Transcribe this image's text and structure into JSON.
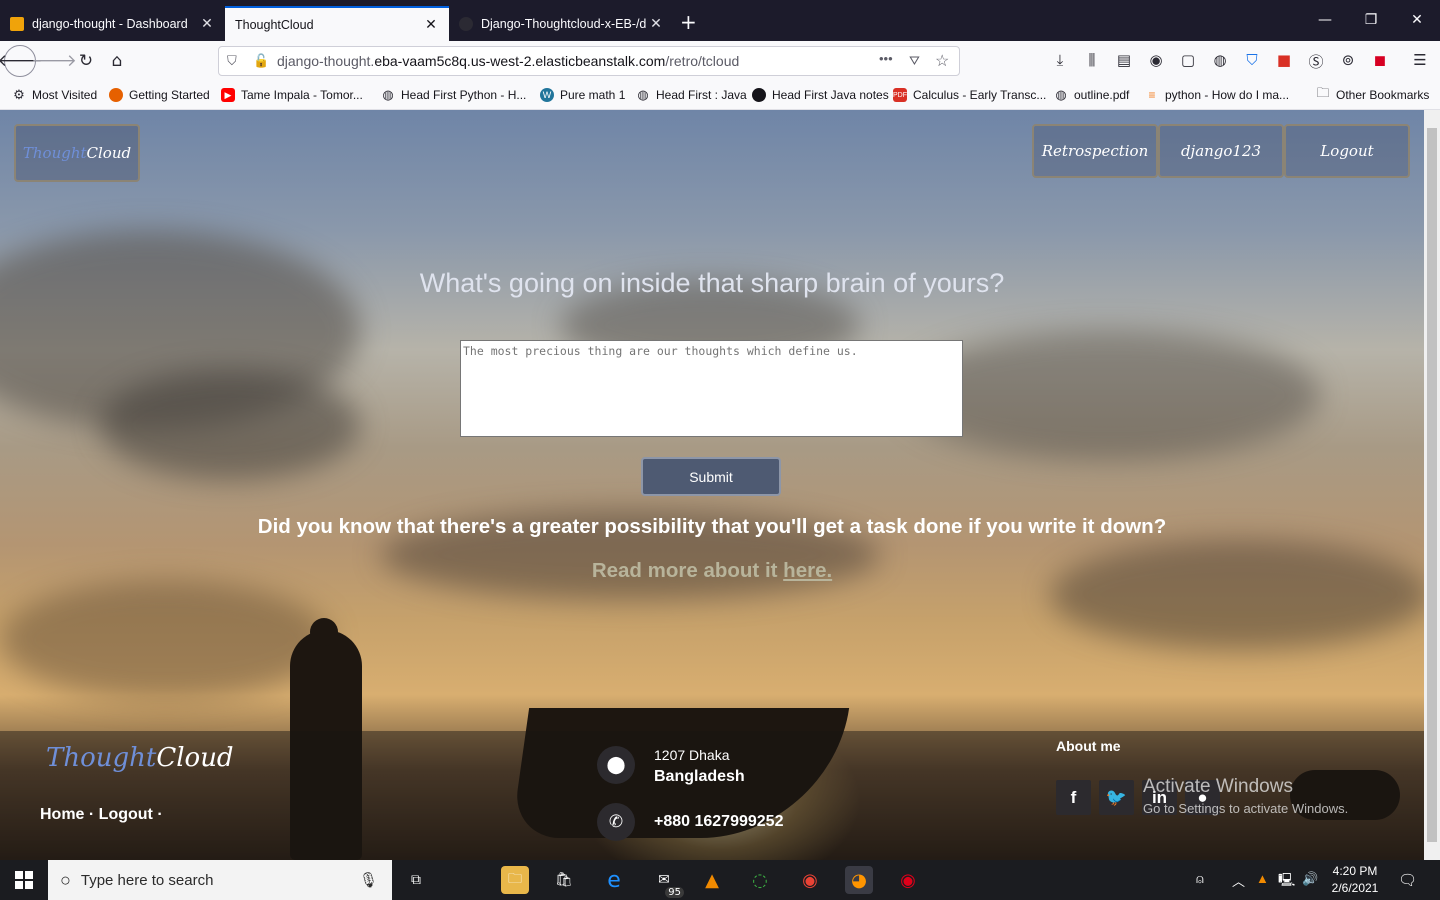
{
  "browser": {
    "tabs": [
      {
        "title": "django-thought - Dashboard",
        "active": false,
        "icon": "aws-box-icon"
      },
      {
        "title": "ThoughtCloud",
        "active": true,
        "icon": ""
      },
      {
        "title": "Django-Thoughtcloud-x-EB-/d",
        "active": false,
        "icon": "github-icon"
      }
    ],
    "url_prefix": "django-thought.",
    "url_domain": "eba-vaam5c8q.us-west-2.elasticbeanstalk.com",
    "url_path": "/retro/tcloud",
    "bookmarks": [
      {
        "label": "Most Visited",
        "icon": "gear-icon"
      },
      {
        "label": "Getting Started",
        "icon": "firefox-icon"
      },
      {
        "label": "Tame Impala - Tomor...",
        "icon": "youtube-icon"
      },
      {
        "label": "Head First Python - H...",
        "icon": "globe-icon"
      },
      {
        "label": "Pure math 1",
        "icon": "wordpress-icon"
      },
      {
        "label": "Head First : Java",
        "icon": "globe-icon"
      },
      {
        "label": "Head First Java notes",
        "icon": "github-icon"
      },
      {
        "label": "Calculus - Early Transc...",
        "icon": "pdf-icon"
      },
      {
        "label": "outline.pdf",
        "icon": "globe-icon"
      },
      {
        "label": "python - How do I ma...",
        "icon": "stackoverflow-icon"
      },
      {
        "label": "Other Bookmarks",
        "icon": "folder-icon"
      }
    ]
  },
  "page": {
    "brand_part1": "Thought",
    "brand_part2": "Cloud",
    "nav": {
      "retrospection": "Retrospection",
      "user": "django123",
      "logout": "Logout"
    },
    "headline": "What's going on inside that sharp brain of yours?",
    "thought_placeholder": "The most precious thing are our thoughts which define us.",
    "submit_label": "Submit",
    "question": "Did you know that there's a greater possibility that you'll get a task done if you write it down?",
    "readmore_text": "Read more about it ",
    "readmore_link": "here."
  },
  "footer": {
    "logo_part1": "Thought",
    "logo_part2": "Cloud",
    "links": "Home · Logout ·",
    "address_line1": "1207 Dhaka",
    "address_line2": "Bangladesh",
    "phone": "+880 1627999252",
    "about_title": "About me",
    "social": [
      "facebook",
      "twitter",
      "linkedin",
      "github"
    ]
  },
  "watermark": {
    "line1": "Activate Windows",
    "line2": "Go to Settings to activate Windows."
  },
  "taskbar": {
    "search_placeholder": "Type here to search",
    "mail_badge": "95",
    "time": "4:20 PM",
    "date": "2/6/2021"
  }
}
